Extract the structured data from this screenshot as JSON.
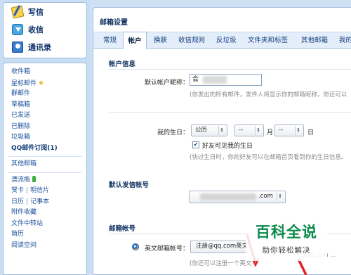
{
  "sidebar": {
    "actions": [
      {
        "label": "写信",
        "icon": "write-pencil-icon"
      },
      {
        "label": "收信",
        "icon": "inbox-arrow-icon"
      },
      {
        "label": "通讯录",
        "icon": "contacts-book-icon"
      }
    ],
    "folders_group1": [
      {
        "label": "收件箱"
      },
      {
        "label": "星标邮件"
      },
      {
        "label": "群邮件"
      },
      {
        "label": "草稿箱"
      },
      {
        "label": "已发送"
      },
      {
        "label": "已删除"
      },
      {
        "label": "垃圾箱"
      },
      {
        "label": "QQ邮件订阅(1)"
      }
    ],
    "other_mailbox": "其他邮箱",
    "folders_group2": {
      "drift_bottle": "漂流瓶",
      "greeting_card": "贺卡",
      "postcard": "明信片",
      "calendar": "日历",
      "notebook": "记事本",
      "attachment_collection": "附件收藏",
      "file_transfer": "文件中转站",
      "resume": "简历",
      "reading_space": "阅读空间"
    },
    "divider": "|"
  },
  "main": {
    "title": "邮箱设置",
    "tabs": [
      {
        "label": "常规"
      },
      {
        "label": "帐户"
      },
      {
        "label": "换肤"
      },
      {
        "label": "收信规则"
      },
      {
        "label": "反垃圾"
      },
      {
        "label": "文件夹和标签"
      },
      {
        "label": "其他邮箱"
      },
      {
        "label": "我的"
      }
    ],
    "active_tab": "帐户",
    "account_info": {
      "heading": "帐户信息",
      "nickname_label": "默认帐户昵称：",
      "nickname_value": "会",
      "nickname_hint": "(你发出的所有邮件，发件人将显示你的邮箱昵称，你还可以",
      "birthday_label": "我的生日：",
      "calendar_type": "公历",
      "month_value": "--",
      "month_unit": "月",
      "day_value": "--",
      "day_unit": "日",
      "friends_visible_label": "好友可见我的生日",
      "friends_visible_checked": true,
      "birthday_hint": "(快过生日时，你的好友可以在邮箱首页看到你的生日信息。"
    },
    "default_sender": {
      "heading": "默认发信帐号",
      "account_suffix": ".com"
    },
    "email_alias": {
      "heading": "邮箱帐号",
      "english_label": "英文邮箱帐号：",
      "register_button": "注册@qq.com英文",
      "hint": "(你还可以注册一个英文"
    }
  },
  "watermark": {
    "title": "百科全说",
    "subtitle": "助你轻松解决",
    "ghost_text": "r@qq.com ..."
  },
  "colors": {
    "accent": "#123d7a",
    "panel_border": "#9cbde0",
    "background": "#cfe1f4",
    "watermark_green": "#0a8a4b",
    "arrow_red": "#e0202a"
  }
}
